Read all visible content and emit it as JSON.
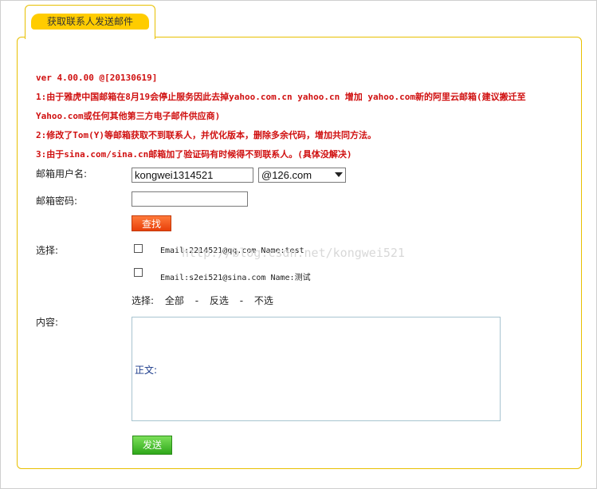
{
  "tab": {
    "label": "获取联系人发送邮件"
  },
  "notes": {
    "version": "ver 4.00.00 @[20130619]",
    "items": [
      "1:由于雅虎中国邮箱在8月19会停止服务因此去掉yahoo.com.cn yahoo.cn 增加 yahoo.com新的阿里云邮箱(建议搬迁至Yahoo.com或任何其他第三方电子邮件供应商)",
      "2:修改了Tom(Y)等邮箱获取不到联系人，并优化版本，删除多余代码，增加共同方法。",
      "3:由于sina.com/sina.cn邮箱加了验证码有时候得不到联系人。(具体没解决)"
    ]
  },
  "form": {
    "username_label": "邮箱用户名:",
    "username_value": "kongwei1314521",
    "domain_selected": "@126.com",
    "password_label": "邮箱密码:",
    "password_value": "",
    "search_button": "查找",
    "select_label": "选择:",
    "contacts": [
      {
        "text": "Email:2214521@qq.com  Name:test",
        "checked": false
      },
      {
        "text": "Email:s2ei521@sina.com  Name:测试",
        "checked": false
      }
    ],
    "selection_prefix": "选择:",
    "select_all": "全部",
    "select_invert": "反选",
    "select_none": "不选",
    "sep": "-",
    "content_label": "内容:",
    "body_text": "正文:",
    "send_button": "发送"
  },
  "watermark": "http://blog.csdn.net/kongwei521",
  "colors": {
    "accent": "#ffcc00",
    "note": "#d01010",
    "search_btn": "#e8400a",
    "send_btn": "#2fa81a"
  }
}
